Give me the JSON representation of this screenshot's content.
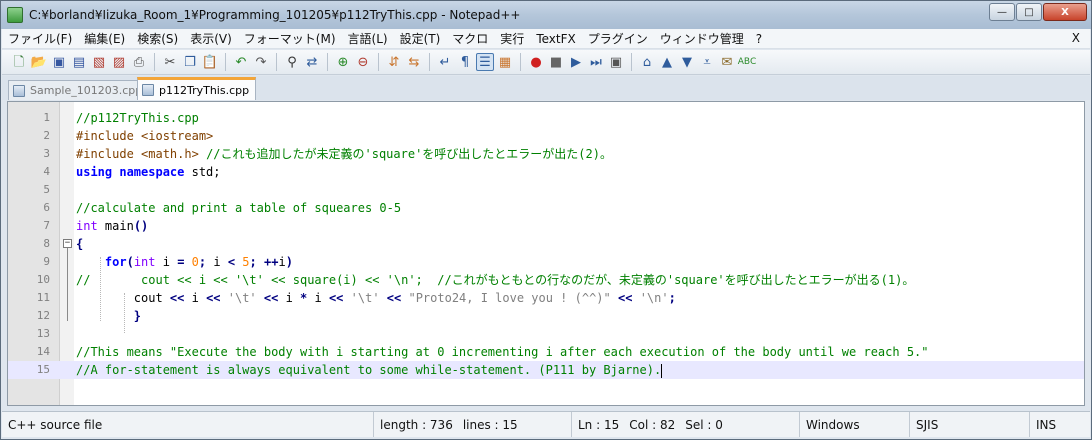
{
  "window": {
    "title": "C:¥borland¥Iizuka_Room_1¥Programming_101205¥p112TryThis.cpp - Notepad++",
    "min_label": "—",
    "max_label": "□",
    "close_label": "X"
  },
  "menu": {
    "items": [
      "ファイル(F)",
      "編集(E)",
      "検索(S)",
      "表示(V)",
      "フォーマット(M)",
      "言語(L)",
      "設定(T)",
      "マクロ",
      "実行",
      "TextFX",
      "プラグイン",
      "ウィンドウ管理",
      "?"
    ],
    "close_label": "X"
  },
  "toolbar": {
    "icons": [
      "new-file-icon",
      "open-file-icon",
      "save-icon",
      "save-all-icon",
      "close-icon",
      "close-all-icon",
      "print-icon",
      "cut-icon",
      "copy-icon",
      "paste-icon",
      "undo-icon",
      "redo-icon",
      "find-icon",
      "replace-icon",
      "zoom-in-icon",
      "zoom-out-icon",
      "sync-vertical-icon",
      "sync-horizontal-icon",
      "word-wrap-icon",
      "show-all-chars-icon",
      "indent-guide-icon",
      "user-lang-icon",
      "record-macro-icon",
      "stop-macro-icon",
      "play-macro-icon",
      "run-macro-multiple-icon",
      "save-macro-icon",
      "textfx-icon",
      "up-icon",
      "down-icon",
      "arrow-down-icon",
      "mail-icon",
      "spellcheck-icon"
    ]
  },
  "tabs": [
    {
      "label": "Sample_101203.cpp",
      "active": false
    },
    {
      "label": "p112TryThis.cpp",
      "active": true
    }
  ],
  "editor": {
    "line_numbers": [
      "1",
      "2",
      "3",
      "4",
      "5",
      "6",
      "7",
      "8",
      "9",
      "10",
      "11",
      "12",
      "13",
      "14",
      "15"
    ],
    "current_line": 15
  },
  "status": {
    "language": "C++ source file",
    "length": "length : 736",
    "lines": "lines : 15",
    "ln": "Ln : 15",
    "col": "Col : 82",
    "sel": "Sel : 0",
    "eol": "Windows",
    "encoding": "SJIS",
    "mode": "INS"
  },
  "colors": {
    "comment": "#008000",
    "preprocessor": "#804000",
    "keyword": "#0000ff",
    "type": "#8000ff",
    "number": "#ff8000",
    "operator": "#000080",
    "string": "#808080",
    "current_line_bg": "#e8e8ff"
  }
}
